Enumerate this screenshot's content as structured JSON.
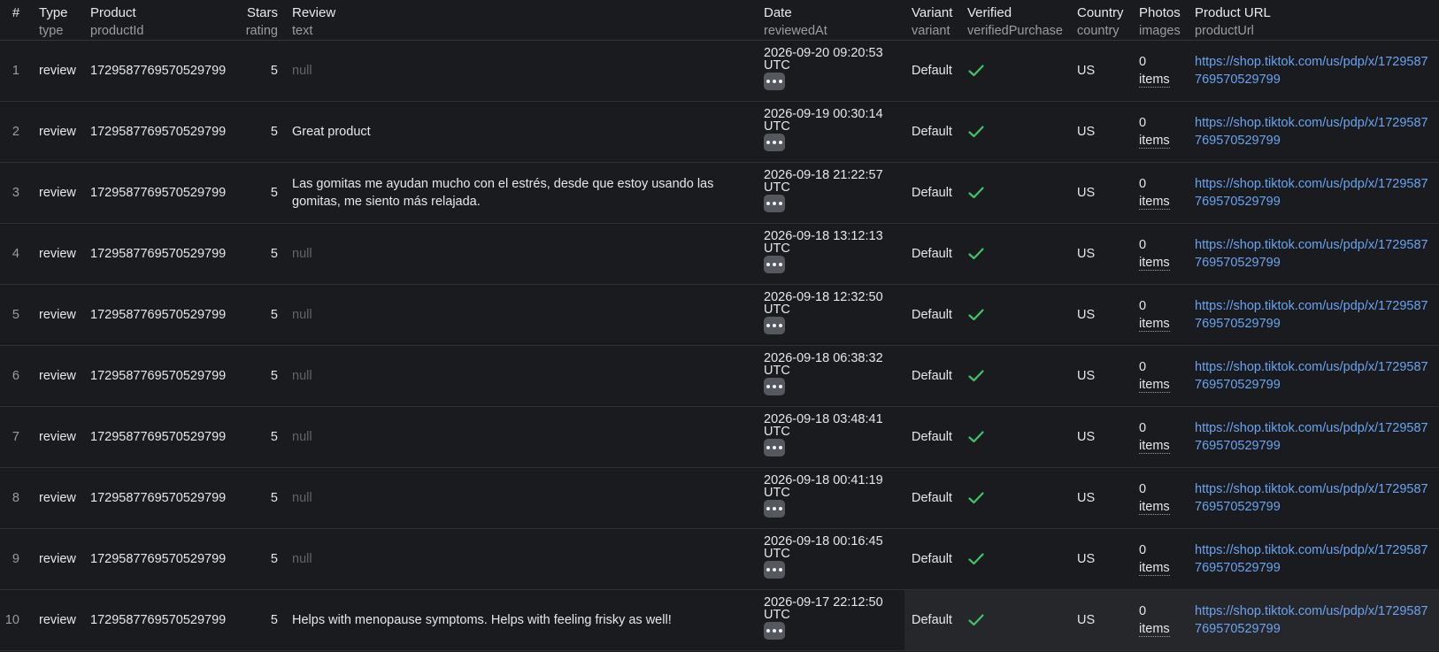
{
  "columns": [
    {
      "title": "#",
      "key": ""
    },
    {
      "title": "Type",
      "key": "type"
    },
    {
      "title": "Product",
      "key": "productId"
    },
    {
      "title": "Stars",
      "key": "rating"
    },
    {
      "title": "Review",
      "key": "text"
    },
    {
      "title": "Date",
      "key": "reviewedAt"
    },
    {
      "title": "Variant",
      "key": "variant"
    },
    {
      "title": "Verified",
      "key": "verifiedPurchase"
    },
    {
      "title": "Country",
      "key": "country"
    },
    {
      "title": "Photos",
      "key": "images"
    },
    {
      "title": "Product URL",
      "key": "productUrl"
    }
  ],
  "rows": [
    {
      "n": "1",
      "type": "review",
      "productId": "1729587769570529799",
      "rating": "5",
      "text": "null",
      "is_null": true,
      "date": "2026-09-20 09:20:53 UTC",
      "variant": "Default",
      "verified": true,
      "country": "US",
      "photos_count": "0",
      "photos_label": "items",
      "url": "https://shop.tiktok.com/us/pdp/x/1729587769570529799"
    },
    {
      "n": "2",
      "type": "review",
      "productId": "1729587769570529799",
      "rating": "5",
      "text": "Great product",
      "is_null": false,
      "date": "2026-09-19 00:30:14 UTC",
      "variant": "Default",
      "verified": true,
      "country": "US",
      "photos_count": "0",
      "photos_label": "items",
      "url": "https://shop.tiktok.com/us/pdp/x/1729587769570529799"
    },
    {
      "n": "3",
      "type": "review",
      "productId": "1729587769570529799",
      "rating": "5",
      "text": "Las gomitas me ayudan mucho con el estrés, desde que estoy usando las gomitas, me siento más relajada.",
      "is_null": false,
      "date": "2026-09-18 21:22:57 UTC",
      "variant": "Default",
      "verified": true,
      "country": "US",
      "photos_count": "0",
      "photos_label": "items",
      "url": "https://shop.tiktok.com/us/pdp/x/1729587769570529799"
    },
    {
      "n": "4",
      "type": "review",
      "productId": "1729587769570529799",
      "rating": "5",
      "text": "null",
      "is_null": true,
      "date": "2026-09-18 13:12:13 UTC",
      "variant": "Default",
      "verified": true,
      "country": "US",
      "photos_count": "0",
      "photos_label": "items",
      "url": "https://shop.tiktok.com/us/pdp/x/1729587769570529799"
    },
    {
      "n": "5",
      "type": "review",
      "productId": "1729587769570529799",
      "rating": "5",
      "text": "null",
      "is_null": true,
      "date": "2026-09-18 12:32:50 UTC",
      "variant": "Default",
      "verified": true,
      "country": "US",
      "photos_count": "0",
      "photos_label": "items",
      "url": "https://shop.tiktok.com/us/pdp/x/1729587769570529799"
    },
    {
      "n": "6",
      "type": "review",
      "productId": "1729587769570529799",
      "rating": "5",
      "text": "null",
      "is_null": true,
      "date": "2026-09-18 06:38:32 UTC",
      "variant": "Default",
      "verified": true,
      "country": "US",
      "photos_count": "0",
      "photos_label": "items",
      "url": "https://shop.tiktok.com/us/pdp/x/1729587769570529799"
    },
    {
      "n": "7",
      "type": "review",
      "productId": "1729587769570529799",
      "rating": "5",
      "text": "null",
      "is_null": true,
      "date": "2026-09-18 03:48:41 UTC",
      "variant": "Default",
      "verified": true,
      "country": "US",
      "photos_count": "0",
      "photos_label": "items",
      "url": "https://shop.tiktok.com/us/pdp/x/1729587769570529799"
    },
    {
      "n": "8",
      "type": "review",
      "productId": "1729587769570529799",
      "rating": "5",
      "text": "null",
      "is_null": true,
      "date": "2026-09-18 00:41:19 UTC",
      "variant": "Default",
      "verified": true,
      "country": "US",
      "photos_count": "0",
      "photos_label": "items",
      "url": "https://shop.tiktok.com/us/pdp/x/1729587769570529799"
    },
    {
      "n": "9",
      "type": "review",
      "productId": "1729587769570529799",
      "rating": "5",
      "text": "null",
      "is_null": true,
      "date": "2026-09-18 00:16:45 UTC",
      "variant": "Default",
      "verified": true,
      "country": "US",
      "photos_count": "0",
      "photos_label": "items",
      "url": "https://shop.tiktok.com/us/pdp/x/1729587769570529799"
    },
    {
      "n": "10",
      "type": "review",
      "productId": "1729587769570529799",
      "rating": "5",
      "text": "Helps with menopause symptoms. Helps with feeling frisky as well!",
      "is_null": false,
      "date": "2026-09-17 22:12:50 UTC",
      "variant": "Default",
      "verified": true,
      "country": "US",
      "photos_count": "0",
      "photos_label": "items",
      "url": "https://shop.tiktok.com/us/pdp/x/1729587769570529799",
      "highlighted": true
    }
  ],
  "icons": {
    "more": "more-horizontal-icon",
    "verified": "checkmark-icon"
  },
  "colors": {
    "background": "#1a1b1e",
    "link": "#6aa3f0",
    "check": "#3fc46a",
    "null_text": "#61646b",
    "muted": "#9a9ca3"
  }
}
